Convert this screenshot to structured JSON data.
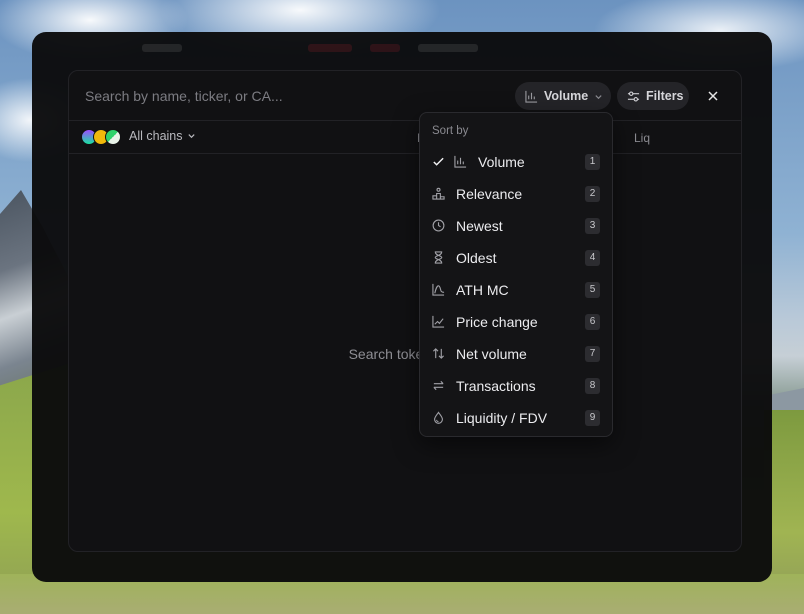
{
  "search": {
    "placeholder": "Search by name, ticker, or CA..."
  },
  "toolbar": {
    "volume_label": "Volume",
    "filters_label": "Filters"
  },
  "filters": {
    "chains_label": "All chains"
  },
  "columns": {
    "mc_partial": "M",
    "liq": "Liq"
  },
  "empty_state": "Search tokens acr",
  "dropdown": {
    "title": "Sort by",
    "items": [
      {
        "label": "Volume",
        "key": "1",
        "icon": "bar-chart-icon",
        "selected": true
      },
      {
        "label": "Relevance",
        "key": "2",
        "icon": "podium-icon",
        "selected": false
      },
      {
        "label": "Newest",
        "key": "3",
        "icon": "clock-icon",
        "selected": false
      },
      {
        "label": "Oldest",
        "key": "4",
        "icon": "hourglass-icon",
        "selected": false
      },
      {
        "label": "ATH MC",
        "key": "5",
        "icon": "peak-chart-icon",
        "selected": false
      },
      {
        "label": "Price change",
        "key": "6",
        "icon": "line-chart-icon",
        "selected": false
      },
      {
        "label": "Net volume",
        "key": "7",
        "icon": "up-down-arrows-icon",
        "selected": false
      },
      {
        "label": "Transactions",
        "key": "8",
        "icon": "transfer-arrows-icon",
        "selected": false
      },
      {
        "label": "Liquidity / FDV",
        "key": "9",
        "icon": "droplet-icon",
        "selected": false
      }
    ]
  },
  "colors": {
    "window_bg": "#0a0a0b",
    "modal_bg": "#111113",
    "pill_bg": "#242428",
    "text_primary": "#ececef",
    "text_muted": "#8a8a90"
  }
}
